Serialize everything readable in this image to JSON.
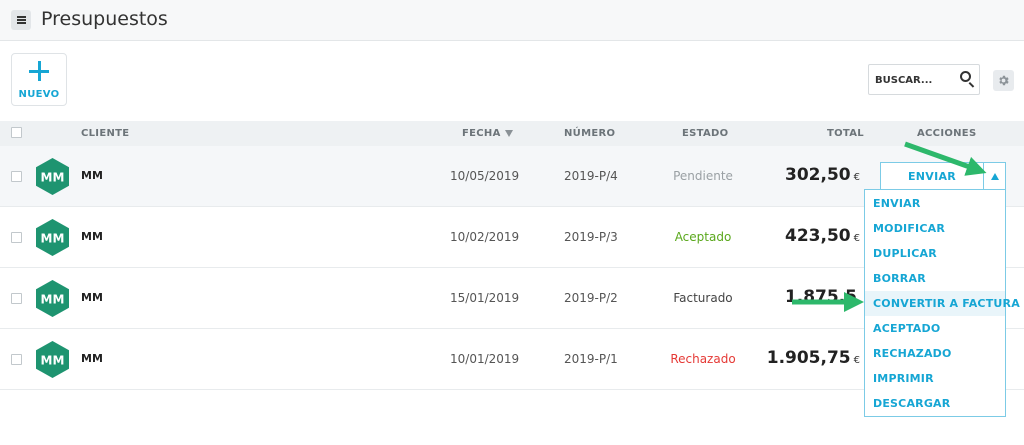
{
  "header": {
    "title": "Presupuestos",
    "menu_icon": "hamburger-icon"
  },
  "toolbar": {
    "new_label": "NUEVO",
    "search_placeholder": "BUSCAR...",
    "search_icon": "search-icon",
    "settings_icon": "gear-icon"
  },
  "table": {
    "columns": {
      "client": "CLIENTE",
      "date": "FECHA",
      "number": "NÚMERO",
      "status": "ESTADO",
      "total": "TOTAL",
      "actions": "ACCIONES"
    },
    "rows": [
      {
        "initials": "MM",
        "client": "MM",
        "date": "10/05/2019",
        "number": "2019-P/4",
        "status": "Pendiente",
        "status_color": "#9aa0a4",
        "total": "302,50",
        "currency": "€"
      },
      {
        "initials": "MM",
        "client": "MM",
        "date": "10/02/2019",
        "number": "2019-P/3",
        "status": "Aceptado",
        "status_color": "#5aa81c",
        "total": "423,50",
        "currency": "€"
      },
      {
        "initials": "MM",
        "client": "MM",
        "date": "15/01/2019",
        "number": "2019-P/2",
        "status": "Facturado",
        "status_color": "#444444",
        "total": "1.875,5",
        "currency": ""
      },
      {
        "initials": "MM",
        "client": "MM",
        "date": "10/01/2019",
        "number": "2019-P/1",
        "status": "Rechazado",
        "status_color": "#e53935",
        "total": "1.905,75",
        "currency": "€"
      }
    ]
  },
  "actions": {
    "primary_label": "ENVIAR",
    "menu": [
      "ENVIAR",
      "MODIFICAR",
      "DUPLICAR",
      "BORRAR",
      "CONVERTIR A FACTURA",
      "ACEPTADO",
      "RECHAZADO",
      "IMPRIMIR",
      "DESCARGAR"
    ],
    "highlighted_item": "CONVERTIR A FACTURA"
  },
  "colors": {
    "accent": "#16a6d4",
    "avatar": "#1e9470",
    "annotation_arrow": "#2db86b"
  }
}
